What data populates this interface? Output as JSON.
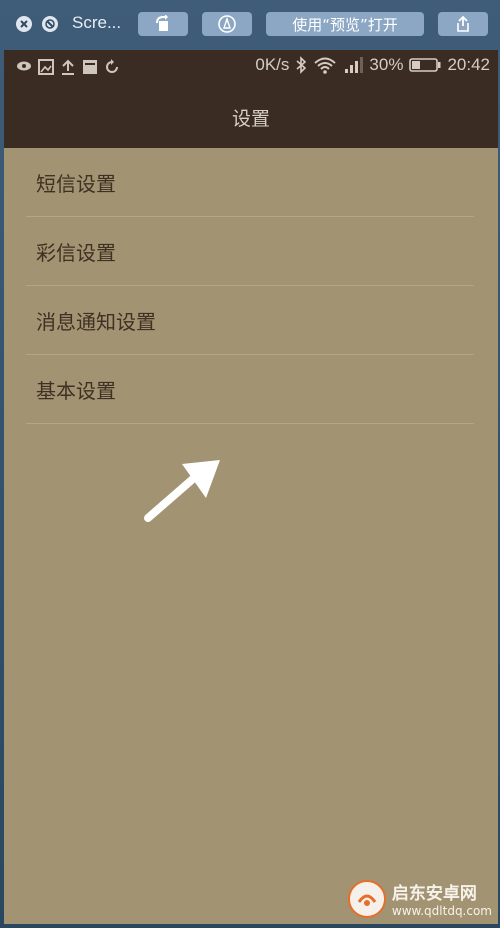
{
  "quicklook": {
    "title": "Scre...",
    "open_button_label": "使用“预览”打开"
  },
  "statusbar": {
    "speed": "0K/s",
    "battery": "30%",
    "time": "20:42"
  },
  "appbar": {
    "title": "设置"
  },
  "settings": {
    "items": [
      {
        "label": "短信设置"
      },
      {
        "label": "彩信设置"
      },
      {
        "label": "消息通知设置"
      },
      {
        "label": "基本设置"
      }
    ]
  },
  "watermark": {
    "brand": "启东安卓网",
    "url": "www.qdltdq.com"
  },
  "colors": {
    "toolbar_bg": "#3f5d79",
    "status_bg": "#3a2c22",
    "page_bg": "#a29372",
    "text": "#3e3123"
  }
}
